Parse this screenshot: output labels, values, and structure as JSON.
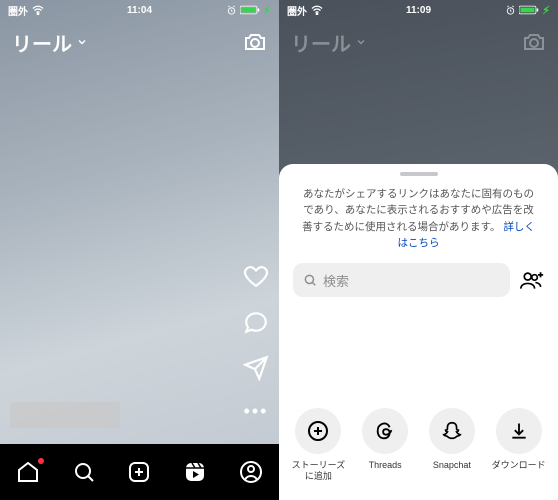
{
  "left": {
    "status": {
      "signal": "圏外",
      "wifi": true,
      "time": "11:04",
      "battery_charging": true
    },
    "header": {
      "title": "リール",
      "chevron": true
    },
    "side_actions": {
      "like_icon": "heart-icon",
      "comment_icon": "comment-icon",
      "share_icon": "share-icon",
      "more_icon": "more-icon"
    },
    "nav": [
      "home",
      "search",
      "create",
      "reels",
      "profile"
    ]
  },
  "right": {
    "status": {
      "signal": "圏外",
      "wifi": true,
      "time": "11:09",
      "battery_charging": true
    },
    "header": {
      "title": "リール",
      "chevron": true
    },
    "sheet": {
      "disclaimer": "あなたがシェアするリンクはあなたに固有のものであり、あなたに表示されるおすすめや広告を改善するために使用される場合があります。",
      "learn_more": "詳しくはこちら",
      "search_placeholder": "検索",
      "add_group_icon": "add-group-icon",
      "targets": [
        {
          "icon": "add-story",
          "label": "ストーリーズに追加"
        },
        {
          "icon": "threads",
          "label": "Threads"
        },
        {
          "icon": "snapchat",
          "label": "Snapchat"
        },
        {
          "icon": "download",
          "label": "ダウンロード"
        }
      ]
    }
  }
}
